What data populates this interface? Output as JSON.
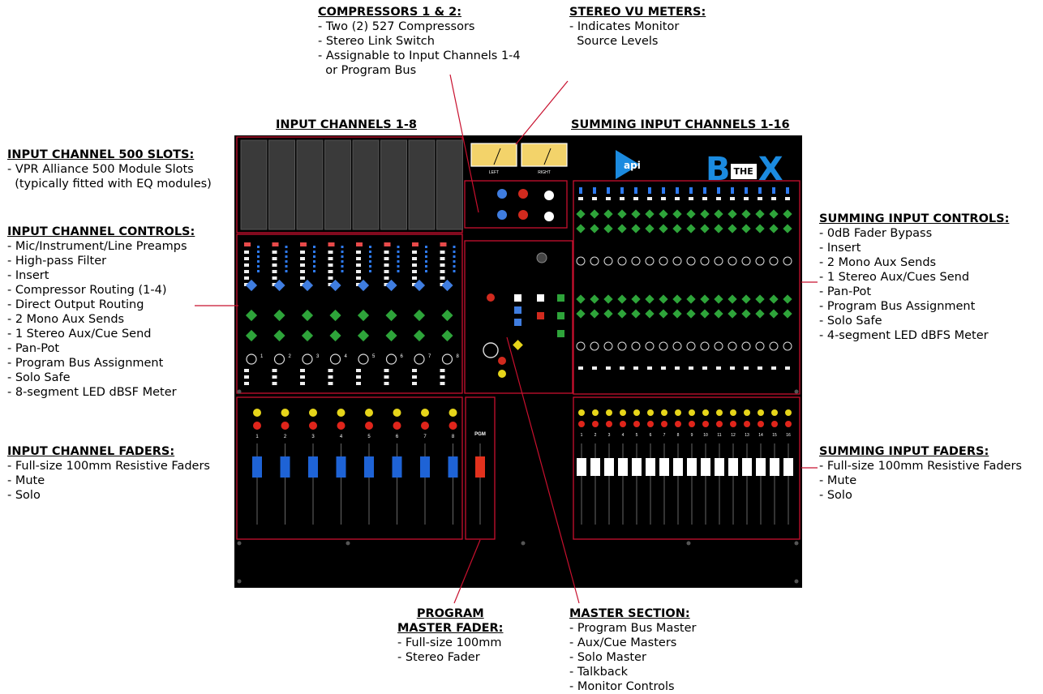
{
  "headings": {
    "input_channels": "INPUT CHANNELS 1-8",
    "summing_channels": "SUMMING INPUT CHANNELS 1-16"
  },
  "compressors": {
    "title": "COMPRESSORS 1 & 2:",
    "items": [
      "- Two (2) 527 Compressors",
      "- Stereo Link Switch",
      "- Assignable to Input Channels 1-4",
      "  or Program Bus"
    ]
  },
  "vu_meters": {
    "title": "STEREO VU METERS:",
    "items": [
      "- Indicates Monitor",
      "  Source Levels"
    ]
  },
  "slots": {
    "title": "INPUT CHANNEL 500 SLOTS:",
    "items": [
      "- VPR Alliance 500 Module Slots",
      "  (typically fitted with EQ modules)"
    ]
  },
  "input_controls": {
    "title": "INPUT CHANNEL CONTROLS:",
    "items": [
      "- Mic/Instrument/Line Preamps",
      "- High-pass Filter",
      "- Insert",
      "- Compressor Routing (1-4)",
      "- Direct Output Routing",
      "- 2 Mono Aux Sends",
      "- 1 Stereo Aux/Cue Send",
      "- Pan-Pot",
      "- Program Bus Assignment",
      "- Solo Safe",
      "- 8-segment LED dBSF Meter"
    ]
  },
  "input_faders": {
    "title": "INPUT CHANNEL FADERS:",
    "items": [
      "- Full-size 100mm Resistive Faders",
      "- Mute",
      "- Solo"
    ]
  },
  "summing_controls": {
    "title": "SUMMING INPUT CONTROLS:",
    "items": [
      "- 0dB Fader Bypass",
      "- Insert",
      "- 2 Mono Aux Sends",
      "- 1 Stereo Aux/Cues Send",
      "- Pan-Pot",
      "- Program Bus Assignment",
      "- Solo Safe",
      "- 4-segment LED dBFS Meter"
    ]
  },
  "summing_faders": {
    "title": "SUMMING INPUT FADERS:",
    "items": [
      "- Full-size 100mm Resistive Faders",
      "- Mute",
      "- Solo"
    ]
  },
  "program_fader": {
    "title_line1": "PROGRAM",
    "title_line2": "MASTER FADER:",
    "items": [
      "- Full-size 100mm",
      "- Stereo Fader"
    ]
  },
  "master_section": {
    "title": "MASTER SECTION:",
    "items": [
      "- Program Bus Master",
      "- Aux/Cue Masters",
      "- Solo Master",
      "- Talkback",
      "- Monitor Controls"
    ]
  },
  "console": {
    "vu_labels": [
      "LEFT",
      "RIGHT"
    ],
    "pgm_label": "PGM",
    "logo_api": "api",
    "logo_box": [
      "B",
      "THE",
      "X"
    ],
    "input_numbers": [
      "1",
      "2",
      "3",
      "4",
      "5",
      "6",
      "7",
      "8"
    ],
    "summing_numbers": [
      "1",
      "2",
      "3",
      "4",
      "5",
      "6",
      "7",
      "8",
      "9",
      "10",
      "11",
      "12",
      "13",
      "14",
      "15",
      "16"
    ],
    "colors": {
      "panel": "#000000",
      "outline": "#c8102e",
      "fader_input": "#1e63d6",
      "fader_program": "#e2311d",
      "fader_summing": "#ffffff",
      "knob_blue": "#3f7de0",
      "knob_green": "#2ea43a",
      "knob_red": "#d12a1e",
      "solo_yellow": "#e6d51a",
      "mute_red": "#e0251b",
      "vu_face": "#f3d36a",
      "leader": "#c8102e"
    }
  }
}
